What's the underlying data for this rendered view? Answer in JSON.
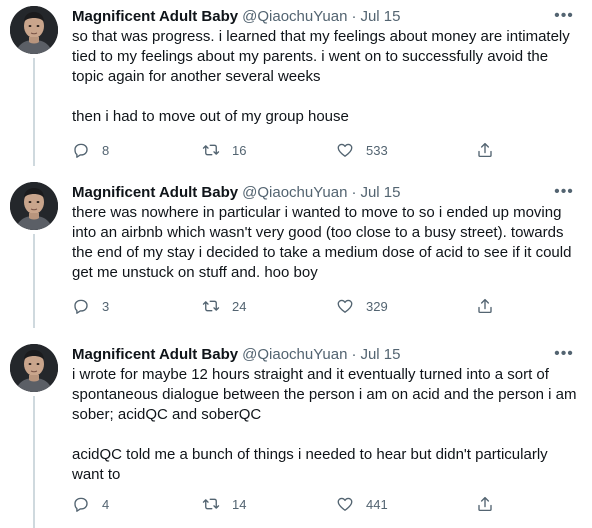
{
  "tweets": [
    {
      "name": "Magnificent Adult Baby",
      "handle": "@QiaochuYuan",
      "separator": "·",
      "time": "Jul 15",
      "paragraphs": [
        "so that was progress. i learned that my feelings about money are intimately tied to my feelings about my parents. i went on to successfully avoid the topic again for another several weeks",
        "then i had to move out of my group house"
      ],
      "replies": "8",
      "retweets": "16",
      "likes": "533"
    },
    {
      "name": "Magnificent Adult Baby",
      "handle": "@QiaochuYuan",
      "separator": "·",
      "time": "Jul 15",
      "paragraphs": [
        "there was nowhere in particular i wanted to move to so i ended up moving into an airbnb which wasn't very good (too close to a busy street). towards the end of my stay i decided to take a medium dose of acid to see if it could get me unstuck on stuff and. hoo boy"
      ],
      "replies": "3",
      "retweets": "24",
      "likes": "329"
    },
    {
      "name": "Magnificent Adult Baby",
      "handle": "@QiaochuYuan",
      "separator": "·",
      "time": "Jul 15",
      "paragraphs": [
        "i wrote for maybe 12 hours straight and it eventually turned into a sort of spontaneous dialogue between the person i am on acid and the person i am sober; acidQC and soberQC",
        "acidQC told me a bunch of things i needed to hear but didn't particularly want to"
      ],
      "replies": "4",
      "retweets": "14",
      "likes": "441"
    }
  ],
  "icons": {
    "more": "more-horizontal-icon",
    "reply": "reply-icon",
    "retweet": "retweet-icon",
    "like": "heart-icon",
    "share": "share-icon"
  },
  "colors": {
    "text": "#0f1419",
    "secondary": "#536471",
    "thread_line": "#cfd9de",
    "divider": "#eff3f4"
  }
}
